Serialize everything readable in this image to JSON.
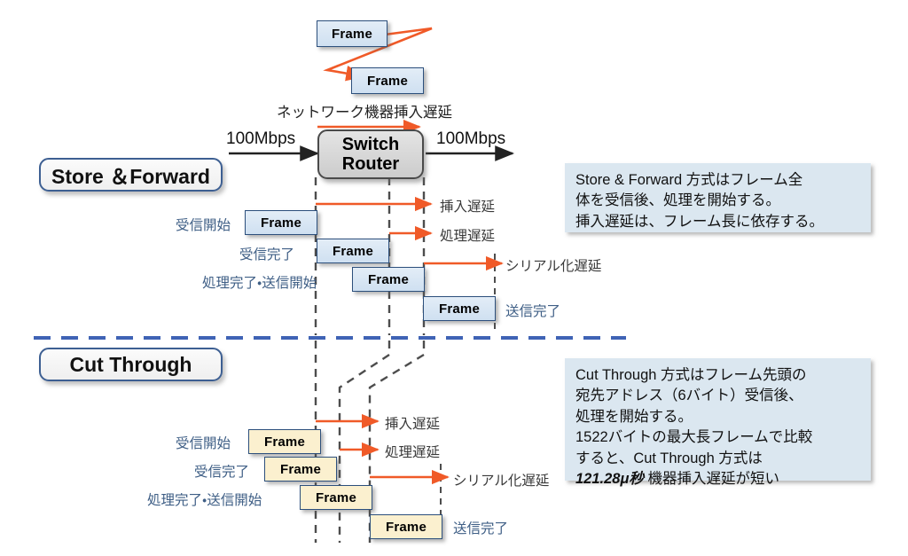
{
  "diagram": {
    "title_top_frames": [
      {
        "label": "Frame"
      },
      {
        "label": "Frame"
      }
    ],
    "network_delay_label": "ネットワーク機器挿入遅延",
    "link_speed_in": "100Mbps",
    "link_speed_out": "100Mbps",
    "device": {
      "line1": "Switch",
      "line2": "Router"
    }
  },
  "store_forward": {
    "badge": "Store ＆Forward",
    "frames": [
      {
        "label": "Frame"
      },
      {
        "label": "Frame"
      },
      {
        "label": "Frame"
      },
      {
        "label": "Frame"
      }
    ],
    "left_labels": [
      {
        "text": "受信開始"
      },
      {
        "text": "受信完了"
      },
      {
        "text": "処理完了・送信開始"
      }
    ],
    "right_labels": [
      {
        "text": "挿入遅延"
      },
      {
        "text": "処理遅延"
      },
      {
        "text": "シリアル化遅延"
      },
      {
        "text": "送信完了"
      }
    ],
    "note": "Store & Forward 方式はフレーム全\n体を受信後、処理を開始する。\n挿入遅延は、フレーム長に依存する。"
  },
  "cut_through": {
    "badge": "Cut Through",
    "frames": [
      {
        "label": "Frame"
      },
      {
        "label": "Frame"
      },
      {
        "label": "Frame"
      },
      {
        "label": "Frame"
      }
    ],
    "left_labels": [
      {
        "text": "受信開始"
      },
      {
        "text": "受信完了"
      },
      {
        "text": "処理完了・送信開始"
      }
    ],
    "right_labels": [
      {
        "text": "挿入遅延"
      },
      {
        "text": "処理遅延"
      },
      {
        "text": "シリアル化遅延"
      },
      {
        "text": "送信完了"
      }
    ],
    "note_line1": "Cut Through 方式はフレーム先頭の",
    "note_line2": "宛先アドレス（6バイト）受信後、",
    "note_line3": "処理を開始する。",
    "note_line4": "1522バイトの最大長フレームで比較",
    "note_line5": "すると、Cut Through 方式は",
    "note_line6_strong": "121.28μ秒",
    "note_line6_rest": " 機器挿入遅延が短い"
  },
  "colors": {
    "arrow_orange": "#f05a28",
    "frame_blue_fill": "#cfe0f1",
    "frame_cream_fill": "#fbf0cf",
    "frame_border": "#2c4f7c",
    "note_bg": "#dbe7f0",
    "divider_blue": "#3f63b5",
    "dashed_gray": "#4d4d4d",
    "label_blue": "#3f5f86"
  }
}
